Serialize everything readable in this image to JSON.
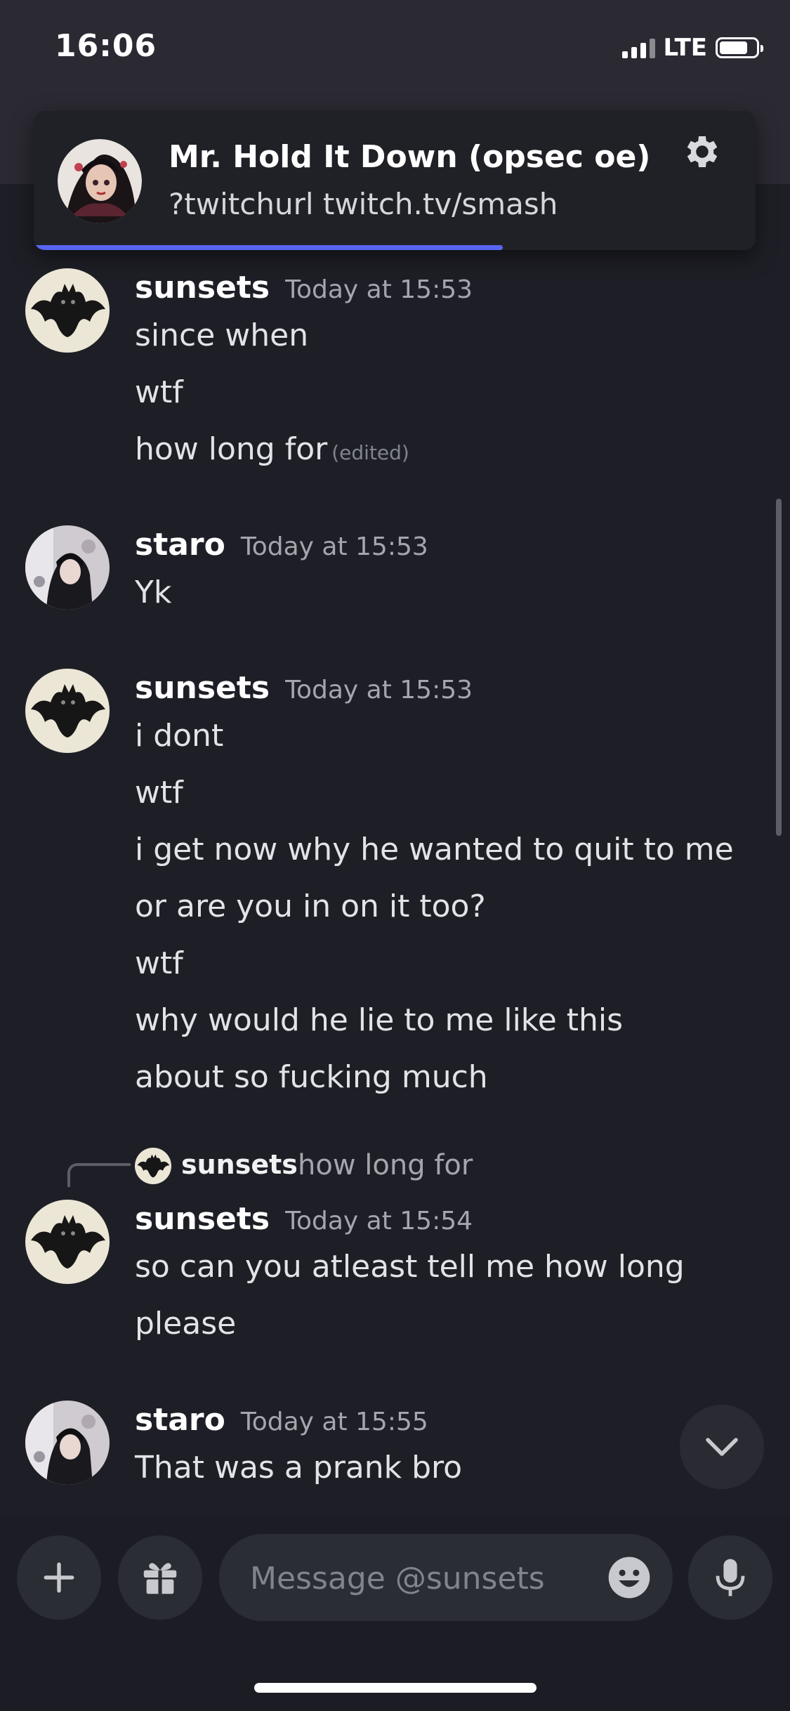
{
  "status_bar": {
    "time": "16:06",
    "network": "LTE"
  },
  "notification": {
    "title": "Mr. Hold It Down (opsec oe)",
    "subtitle": "?twitchurl twitch.tv/smash",
    "progress_fraction": 0.65,
    "accent_color": "#5865f2",
    "icon": "gear-icon"
  },
  "messages": [
    {
      "author": "sunsets",
      "timestamp": "Today at 15:53",
      "avatar": "bat-avatar",
      "lines": [
        "since when",
        "wtf",
        "how long for"
      ],
      "edited_label": "(edited)"
    },
    {
      "author": "staro",
      "timestamp": "Today at 15:53",
      "avatar": "photo-avatar",
      "lines": [
        "Yk"
      ]
    },
    {
      "author": "sunsets",
      "timestamp": "Today at 15:53",
      "avatar": "bat-avatar",
      "lines": [
        "i dont",
        "wtf",
        "i get now why he wanted to quit to me",
        "or are you in on it too?",
        "wtf",
        "why would he lie to me like this",
        "about so fucking much"
      ]
    },
    {
      "reply": {
        "author": "sunsets",
        "text": "how long for"
      },
      "author": "sunsets",
      "timestamp": "Today at 15:54",
      "avatar": "bat-avatar",
      "lines": [
        "so can you atleast tell me how long",
        "please"
      ]
    },
    {
      "author": "staro",
      "timestamp": "Today at 15:55",
      "avatar": "photo-avatar",
      "lines": [
        "That was a prank bro"
      ]
    }
  ],
  "composer": {
    "placeholder": "Message @sunsets",
    "icons": [
      "plus-icon",
      "gift-icon",
      "emoji-icon",
      "microphone-icon"
    ]
  }
}
